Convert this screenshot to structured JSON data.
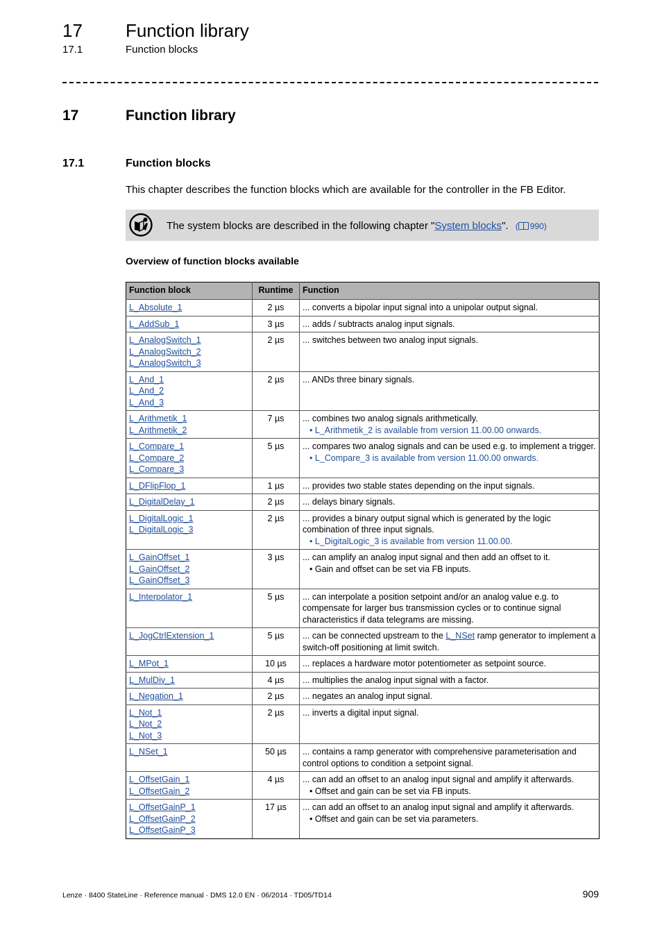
{
  "header": {
    "chapter_number": "17",
    "chapter_title": "Function library",
    "section_number": "17.1",
    "section_title": "Function blocks"
  },
  "heading1": {
    "number": "17",
    "title": "Function library"
  },
  "heading2": {
    "number": "17.1",
    "title": "Function blocks"
  },
  "intro": "This chapter describes the function blocks which are available for the controller in the FB Editor.",
  "note": {
    "icon": "tip-icon",
    "text_before": "The system blocks are described in the following chapter \"",
    "link": "System blocks",
    "text_after": "\".",
    "ref_icon": "book-icon",
    "ref_page": "990"
  },
  "overview_title": "Overview of function blocks available",
  "table": {
    "headers": [
      "Function block",
      "Runtime",
      "Function"
    ],
    "rows": [
      {
        "blocks": [
          "L_Absolute_1"
        ],
        "runtime": "2 µs",
        "function": "... converts a bipolar input signal into a unipolar output signal.",
        "bullets": []
      },
      {
        "blocks": [
          "L_AddSub_1"
        ],
        "runtime": "3 µs",
        "function": "... adds / subtracts analog input signals.",
        "bullets": []
      },
      {
        "blocks": [
          "L_AnalogSwitch_1",
          "L_AnalogSwitch_2",
          "L_AnalogSwitch_3"
        ],
        "runtime": "2 µs",
        "function": "... switches between two analog input signals.",
        "bullets": []
      },
      {
        "blocks": [
          "L_And_1",
          "L_And_2",
          "L_And_3"
        ],
        "runtime": "2 µs",
        "function": "... ANDs three binary signals.",
        "bullets": []
      },
      {
        "blocks": [
          "L_Arithmetik_1",
          "L_Arithmetik_2"
        ],
        "runtime": "7 µs",
        "function": "... combines two analog signals arithmetically.",
        "bullets": [
          {
            "text": "L_Arithmetik_2 is available from version 11.00.00 onwards.",
            "highlight": true
          }
        ]
      },
      {
        "blocks": [
          "L_Compare_1",
          "L_Compare_2",
          "L_Compare_3"
        ],
        "runtime": "5 µs",
        "function": "... compares two analog signals and can be used e.g. to implement a trigger.",
        "bullets": [
          {
            "text": "L_Compare_3 is available from version 11.00.00 onwards.",
            "highlight": true
          }
        ]
      },
      {
        "blocks": [
          "L_DFlipFlop_1"
        ],
        "runtime": "1 µs",
        "function": "... provides two stable states depending on the input signals.",
        "bullets": []
      },
      {
        "blocks": [
          "L_DigitalDelay_1"
        ],
        "runtime": "2 µs",
        "function": "... delays binary signals.",
        "bullets": []
      },
      {
        "blocks": [
          "L_DigitalLogic_1",
          "L_DigitalLogic_3"
        ],
        "runtime": "2 µs",
        "function": "... provides a binary output signal which is generated by the logic combination of three input signals.",
        "bullets": [
          {
            "text": "L_DigitalLogic_3 is available from version 11.00.00.",
            "highlight": true
          }
        ]
      },
      {
        "blocks": [
          "L_GainOffset_1",
          "L_GainOffset_2",
          "L_GainOffset_3"
        ],
        "runtime": "3 µs",
        "function": "... can amplify an analog input signal and then add an offset to it.",
        "bullets": [
          {
            "text": "Gain and offset can be set via FB inputs.",
            "highlight": false
          }
        ]
      },
      {
        "blocks": [
          "L_Interpolator_1"
        ],
        "runtime": "5 µs",
        "function": "... can interpolate a position setpoint and/or an analog value e.g. to compensate for larger bus transmission cycles or to continue signal characteristics if data telegrams are missing.",
        "bullets": []
      },
      {
        "blocks": [
          "L_JogCtrlExtension_1"
        ],
        "runtime": "5 µs",
        "function_parts": [
          "... can be connected upstream to the ",
          "L_NSet",
          " ramp generator to implement a switch-off positioning at limit switch."
        ],
        "bullets": []
      },
      {
        "blocks": [
          "L_MPot_1"
        ],
        "runtime": "10 µs",
        "function": "... replaces a hardware motor potentiometer as setpoint source.",
        "bullets": []
      },
      {
        "blocks": [
          "L_MulDiv_1"
        ],
        "runtime": "4 µs",
        "function": "... multiplies the analog input signal with a factor.",
        "bullets": []
      },
      {
        "blocks": [
          "L_Negation_1"
        ],
        "runtime": "2 µs",
        "function": "... negates an analog input signal.",
        "bullets": []
      },
      {
        "blocks": [
          "L_Not_1",
          "L_Not_2",
          "L_Not_3"
        ],
        "runtime": "2 µs",
        "function": "... inverts a digital input signal.",
        "bullets": []
      },
      {
        "blocks": [
          "L_NSet_1"
        ],
        "runtime": "50 µs",
        "function": "... contains a ramp generator with comprehensive parameterisation and control options to condition a setpoint signal.",
        "bullets": []
      },
      {
        "blocks": [
          "L_OffsetGain_1",
          "L_OffsetGain_2"
        ],
        "runtime": "4 µs",
        "function": "... can add an offset to an analog input signal and amplify it afterwards.",
        "bullets": [
          {
            "text": "Offset and gain can be set via FB inputs.",
            "highlight": false
          }
        ]
      },
      {
        "blocks": [
          "L_OffsetGainP_1",
          "L_OffsetGainP_2",
          "L_OffsetGainP_3"
        ],
        "runtime": "17 µs",
        "function": "... can add an offset to an analog input signal and amplify it afterwards.",
        "bullets": [
          {
            "text": "Offset and gain can be set via parameters.",
            "highlight": false
          }
        ]
      }
    ]
  },
  "footer": {
    "text": "Lenze · 8400 StateLine · Reference manual · DMS 12.0 EN · 06/2014 · TD05/TD14",
    "page_number": "909"
  },
  "colors": {
    "link": "#1f4e9c",
    "note_background": "#d9d9d9",
    "table_header_background": "#b3b3b3"
  }
}
